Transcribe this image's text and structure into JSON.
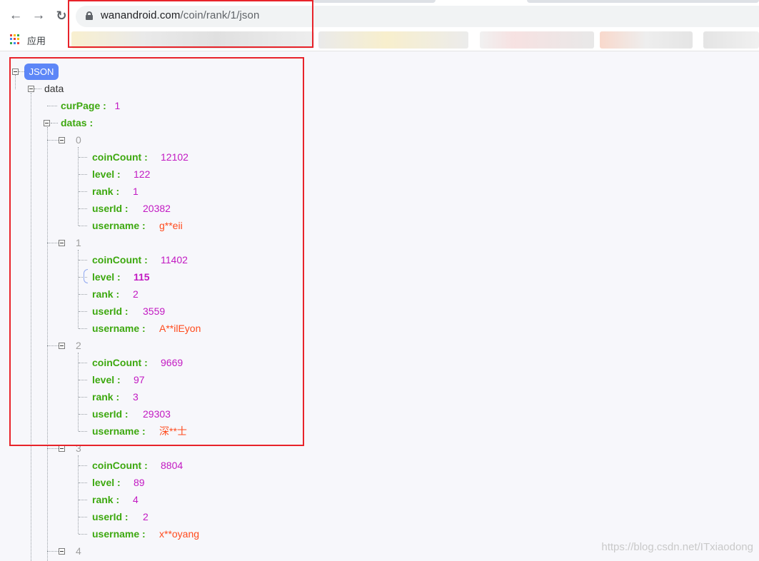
{
  "browser": {
    "url_host": "wanandroid.com",
    "url_path": "/coin/rank/1/json",
    "bookmarks_apps_label": "应用",
    "nav": {
      "back_icon": "arrow-left-icon",
      "forward_icon": "arrow-right-icon",
      "reload_icon": "reload-icon"
    }
  },
  "viewer": {
    "root_label": "JSON",
    "data_label": "data",
    "curPage_key": "curPage :",
    "curPage_value": "1",
    "datas_key": "datas :",
    "field_keys": {
      "coinCount": "coinCount :",
      "level": "level :",
      "rank": "rank :",
      "userId": "userId :",
      "username": "username :"
    },
    "items": [
      {
        "index": "0",
        "coinCount": "12102",
        "level": "122",
        "rank": "1",
        "userId": "20382",
        "username": "g**eii"
      },
      {
        "index": "1",
        "coinCount": "11402",
        "level": "115",
        "rank": "2",
        "userId": "3559",
        "username": "A**ilEyon"
      },
      {
        "index": "2",
        "coinCount": "9669",
        "level": "97",
        "rank": "3",
        "userId": "29303",
        "username": "深**士"
      },
      {
        "index": "3",
        "coinCount": "8804",
        "level": "89",
        "rank": "4",
        "userId": "2",
        "username": "x**oyang"
      },
      {
        "index": "4"
      }
    ]
  },
  "watermark": "https://blog.csdn.net/ITxiaodong",
  "colors": {
    "key": "#3da80f",
    "number": "#c219c2",
    "string": "#ff4a1c",
    "badge": "#5d86f7",
    "highlight": "#e8232a"
  }
}
